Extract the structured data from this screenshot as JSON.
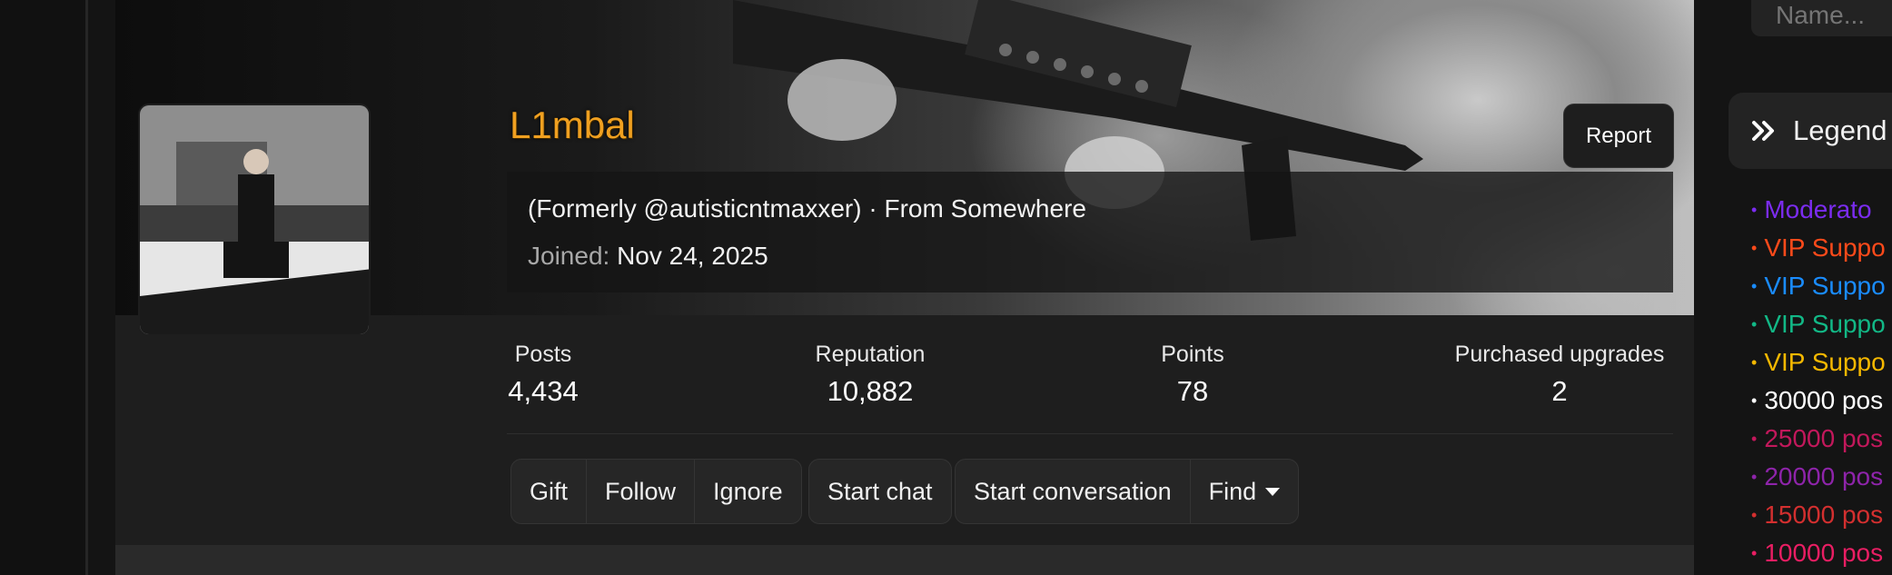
{
  "profile": {
    "username": "L1mbal",
    "report_label": "Report",
    "formerly": "(Formerly @autisticntmaxxer) · From Somewhere",
    "joined_label": "Joined:",
    "joined_date": "Nov 24, 2025"
  },
  "stats": [
    {
      "label": "Posts",
      "value": "4,434"
    },
    {
      "label": "Reputation",
      "value": "10,882"
    },
    {
      "label": "Points",
      "value": "78"
    },
    {
      "label": "Purchased upgrades",
      "value": "2"
    }
  ],
  "actions": {
    "gift": "Gift",
    "follow": "Follow",
    "ignore": "Ignore",
    "start_chat": "Start chat",
    "start_conversation": "Start conversation",
    "find": "Find"
  },
  "sidebar": {
    "name_placeholder": "Name...",
    "legend_title": "Legend",
    "legend_items": [
      {
        "label": "Moderato",
        "color": "#7b2cf0"
      },
      {
        "label": "VIP Suppo",
        "color": "#ff4a1a"
      },
      {
        "label": "VIP Suppo",
        "color": "#1a8cff"
      },
      {
        "label": "VIP Suppo",
        "color": "#12b886"
      },
      {
        "label": "VIP Suppo",
        "color": "#f5b800"
      },
      {
        "label": "30000 pos",
        "color": "#ffffff"
      },
      {
        "label": "25000 pos",
        "color": "#c2185b"
      },
      {
        "label": "20000 pos",
        "color": "#8e24aa"
      },
      {
        "label": "15000 pos",
        "color": "#d32f2f"
      },
      {
        "label": "10000 pos",
        "color": "#e91e63"
      }
    ]
  },
  "colors": {
    "username": "#f0a020",
    "background": "#141414",
    "card": "#1e1e1e"
  }
}
